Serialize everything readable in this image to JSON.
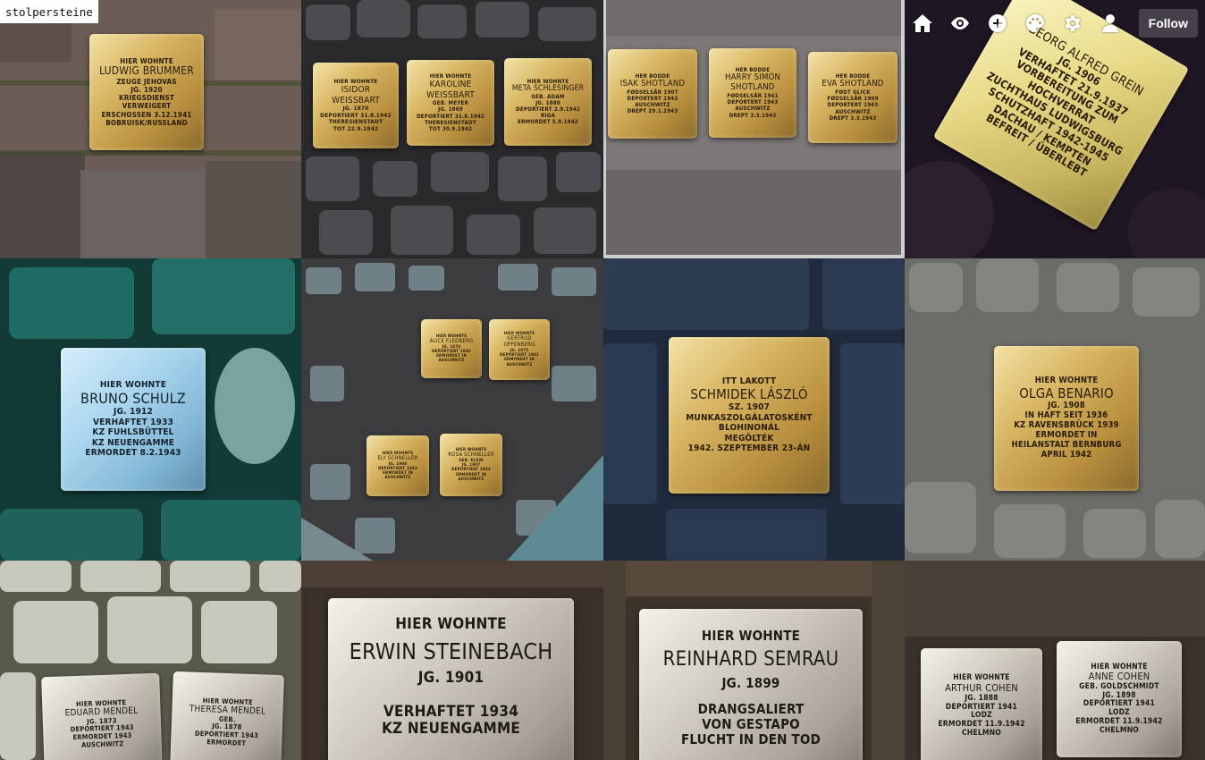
{
  "brand": {
    "title": "stolpersteine"
  },
  "nav": {
    "icons": [
      "home-icon",
      "eye-icon",
      "plus-circle-icon",
      "palette-icon",
      "gear-icon",
      "user-icon"
    ],
    "follow_label": "Follow"
  },
  "tiles": {
    "t1": {
      "lines": [
        "HIER WOHNTE",
        "LUDWIG BRUMMER",
        "ZEUGE JEHOVAS",
        "JG. 1920",
        "KRIEGSDIENST",
        "VERWEIGERT",
        "ERSCHOSSEN 3.12.1941",
        "BOBRUISK/RUSSLAND"
      ]
    },
    "t2a": {
      "lines": [
        "HIER WOHNTE",
        "ISIDOR",
        "WEISSBART",
        "JG. 1870",
        "DEPORTIERT 31.8.1942",
        "THERESIENSTADT",
        "TOT 22.9.1942"
      ]
    },
    "t2b": {
      "lines": [
        "HIER WOHNTE",
        "KAROLINE",
        "WEISSBART",
        "GEB. MEYER",
        "JG. 1869",
        "DEPORTIERT 31.8.1942",
        "THERESIENSTADT",
        "TOT 30.9.1942"
      ]
    },
    "t2c": {
      "lines": [
        "HIER WOHNTE",
        "META SCHLESINGER",
        "GEB. ADAM",
        "JG. 1880",
        "DEPORTIERT 2.9.1942",
        "RIGA",
        "ERMORDET 5.9.1942"
      ]
    },
    "t3a": {
      "lines": [
        "HER BODDE",
        "ISAK SHOTLAND",
        "FØDSELSÅR 1907",
        "DEPORTERT 1942",
        "AUSCHWITZ",
        "DREPT 29.1.1943"
      ]
    },
    "t3b": {
      "lines": [
        "HER BODDE",
        "HARRY SIMON",
        "SHOTLAND",
        "FØDSELSÅR 1941",
        "DEPORTERT 1943",
        "AUSCHWITZ",
        "DREPT 3.3.1943"
      ]
    },
    "t3c": {
      "lines": [
        "HER BODDE",
        "EVA SHOTLAND",
        "FØDT GLICK",
        "FØDSELSÅR 1909",
        "DEPORTERT 1943",
        "AUSCHWITZ",
        "DREPT 3.3.1943"
      ]
    },
    "t4": {
      "lines": [
        "GEORG ALFRED GREIN",
        "JG. 1906",
        "VERHAFTET 21.9.1937",
        "VORBEREITUNG ZUM",
        "HOCHVERRAT",
        "ZUCHTHAUS LUDWIGSBURG",
        "SCHUTZHAFT 1942-1945",
        "DACHAU / KEMPTEN",
        "BEFREIT / ÜBERLEBT"
      ]
    },
    "t5": {
      "lines": [
        "HIER WOHNTE",
        "BRUNO SCHULZ",
        "JG. 1912",
        "VERHAFTET 1933",
        "KZ FUHLSBÜTTEL",
        "KZ NEUENGAMME",
        "ERMORDET 8.2.1943"
      ]
    },
    "t6a": {
      "lines": [
        "HIER WOHNTE",
        "ALICE FLEDBERG",
        "JG. 1874",
        "DEPORTIERT 1942",
        "ERMORDET IN",
        "AUSCHWITZ"
      ]
    },
    "t6b": {
      "lines": [
        "HIER WOHNTE",
        "GERTRUD",
        "OPPENBERG",
        "JG. 1875",
        "DEPORTIERT 1942",
        "ERMORDET IN",
        "AUSCHWITZ"
      ]
    },
    "t6c": {
      "lines": [
        "HIER WOHNTE",
        "ELY SCHNELLER",
        "JG. 1908",
        "DEPORTIERT 1943",
        "ERMORDET IN",
        "AUSCHWITZ"
      ]
    },
    "t6d": {
      "lines": [
        "HIER WOHNTE",
        "ROSA SCHNELLER",
        "GEB. KLEIN",
        "JG. 1907",
        "DEPORTIERT 1943",
        "ERMORDET IN",
        "AUSCHWITZ"
      ]
    },
    "t7": {
      "lines": [
        "ITT LAKOTT",
        "SCHMIDEK LÁSZLÓ",
        "SZ. 1907",
        "MUNKASZOLGÁLATOSKÉNT",
        "BLOHINONÁL",
        "MEGÖLTÉK",
        "1942. SZEPTEMBER 23-ÁN"
      ]
    },
    "t8": {
      "lines": [
        "HIER WOHNTE",
        "OLGA BENARIO",
        "JG. 1908",
        "IN HAFT SEIT 1936",
        "KZ RAVENSBRÜCK 1939",
        "ERMORDET IN",
        "HEILANSTALT BERNBURG",
        "APRIL 1942"
      ]
    },
    "t9a": {
      "lines": [
        "HIER WOHNTE",
        "EDUARD MENDEL",
        "JG. 1873",
        "DEPORTIERT 1943",
        "ERMORDET 1943",
        "AUSCHWITZ"
      ]
    },
    "t9b": {
      "lines": [
        "HIER WOHNTE",
        "THERESA MENDEL",
        "GEB.",
        "JG. 1878",
        "DEPORTIERT 1943",
        "ERMORDET"
      ]
    },
    "t10": {
      "lines": [
        "HIER WOHNTE",
        "ERWIN STEINEBACH",
        "JG. 1901",
        "VERHAFTET 1934",
        "KZ NEUENGAMME"
      ]
    },
    "t11": {
      "lines": [
        "HIER WOHNTE",
        "REINHARD SEMRAU",
        "JG. 1899",
        "DRANGSALIERT",
        "VON GESTAPO",
        "FLUCHT IN DEN TOD"
      ]
    },
    "t12a": {
      "lines": [
        "HIER WOHNTE",
        "ARTHUR COHEN",
        "JG. 1888",
        "DEPORTIERT 1941",
        "LODZ",
        "ERMORDET 11.9.1942",
        "CHELMNO"
      ]
    },
    "t12b": {
      "lines": [
        "HIER WOHNTE",
        "ANNE COHEN",
        "GEB. GOLDSCHMIDT",
        "JG. 1898",
        "DEPORTIERT 1941",
        "LODZ",
        "ERMORDET 11.9.1942",
        "CHELMNO"
      ]
    }
  }
}
